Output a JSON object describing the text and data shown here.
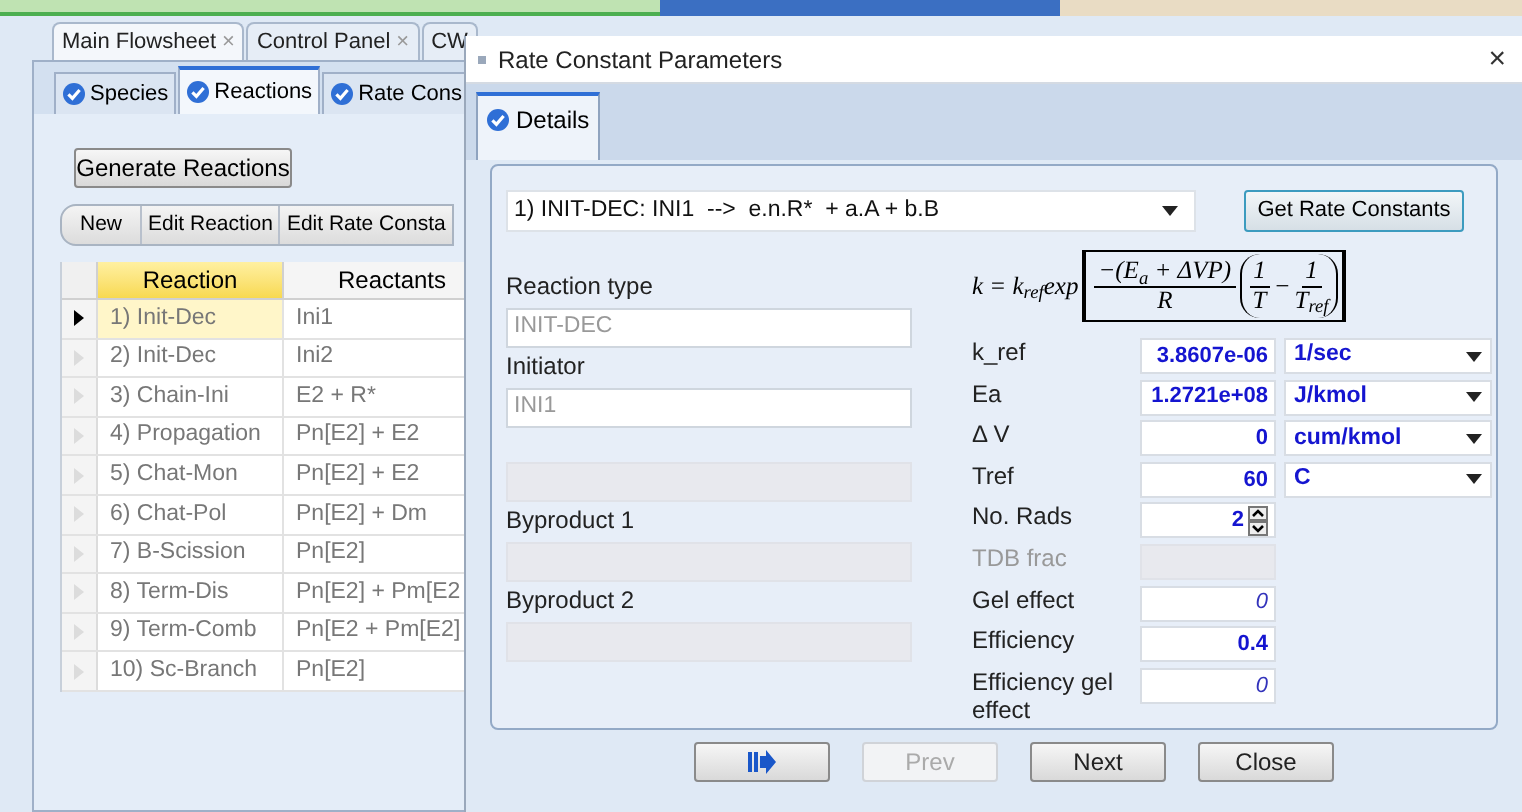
{
  "doc_tabs": [
    {
      "label": "Main Flowsheet",
      "close": "×",
      "selected": true
    },
    {
      "label": "Control Panel",
      "close": "×",
      "selected": false
    },
    {
      "label": "CW",
      "selected": false
    }
  ],
  "sub_tabs": [
    {
      "label": "Species",
      "selected": false
    },
    {
      "label": "Reactions",
      "selected": true
    },
    {
      "label": "Rate Cons",
      "selected": false
    }
  ],
  "generate_button": "Generate Reactions",
  "toolbar": [
    "New",
    "Edit Reaction",
    "Edit Rate Consta"
  ],
  "grid": {
    "columns": [
      "Reaction",
      "Reactants"
    ],
    "rows": [
      {
        "reaction": "1) Init-Dec",
        "reactants": "Ini1",
        "selected": true
      },
      {
        "reaction": "2) Init-Dec",
        "reactants": "Ini2",
        "selected": false
      },
      {
        "reaction": "3) Chain-Ini",
        "reactants": "E2 + R*",
        "selected": false
      },
      {
        "reaction": "4) Propagation",
        "reactants": "Pn[E2] + E2",
        "selected": false
      },
      {
        "reaction": "5) Chat-Mon",
        "reactants": "Pn[E2] + E2",
        "selected": false
      },
      {
        "reaction": "6) Chat-Pol",
        "reactants": "Pn[E2] + Dm",
        "selected": false
      },
      {
        "reaction": "7) B-Scission",
        "reactants": "Pn[E2]",
        "selected": false
      },
      {
        "reaction": "8) Term-Dis",
        "reactants": "Pn[E2] + Pm[E2",
        "selected": false
      },
      {
        "reaction": "9) Term-Comb",
        "reactants": "Pn[E2 + Pm[E2]",
        "selected": false
      },
      {
        "reaction": "10) Sc-Branch",
        "reactants": "Pn[E2]",
        "selected": false
      }
    ]
  },
  "dialog": {
    "title": "Rate Constant Parameters",
    "close": "×",
    "tabs": [
      {
        "label": "Details",
        "selected": true
      }
    ],
    "reaction_select": "1) INIT-DEC: INI1  -->  e.n.R*  + a.A + b.B",
    "get_button": "Get Rate Constants",
    "fields": [
      {
        "label": "Reaction type",
        "value": "INIT-DEC",
        "disabled": false
      },
      {
        "label": "Initiator",
        "value": "INI1",
        "disabled": false
      },
      {
        "disabled": true
      },
      {
        "label": "Byproduct 1",
        "disabled": true
      },
      {
        "label": "Byproduct 2",
        "disabled": true
      }
    ],
    "formula": {
      "lhs": "k = k$_{ref}$exp",
      "numerator": "−(E$_{a}$ + ΔVP)",
      "denominator": "R",
      "frac1_num": "1",
      "frac1_den": "T",
      "minus": "−",
      "frac2_num": "1",
      "frac2_den": "T$_{ref}$"
    },
    "params": [
      {
        "label": "k_ref",
        "value": "3.8607e-06",
        "unit": "1/sec",
        "kind": "unit"
      },
      {
        "label": "Ea",
        "value": "1.2721e+08",
        "unit": "J/kmol",
        "kind": "unit"
      },
      {
        "label": "Δ V",
        "value": "0",
        "unit": "cum/kmol",
        "kind": "unit"
      },
      {
        "label": "Tref",
        "value": "60",
        "unit": "C",
        "kind": "unit"
      },
      {
        "label": "No. Rads",
        "value": "2",
        "kind": "spin"
      },
      {
        "label": "TDB frac",
        "kind": "empty"
      },
      {
        "label": "Gel effect",
        "value": "0",
        "kind": "default"
      },
      {
        "label": "Efficiency",
        "value": "0.4",
        "kind": "value"
      },
      {
        "label": "Efficiency gel effect",
        "value": "0",
        "kind": "default"
      }
    ],
    "buttons": [
      {
        "kind": "icon",
        "disabled": false
      },
      {
        "kind": "text",
        "label": "Prev",
        "disabled": true
      },
      {
        "kind": "text",
        "label": "Next",
        "disabled": false
      },
      {
        "kind": "text",
        "label": "Close",
        "disabled": false
      }
    ]
  }
}
